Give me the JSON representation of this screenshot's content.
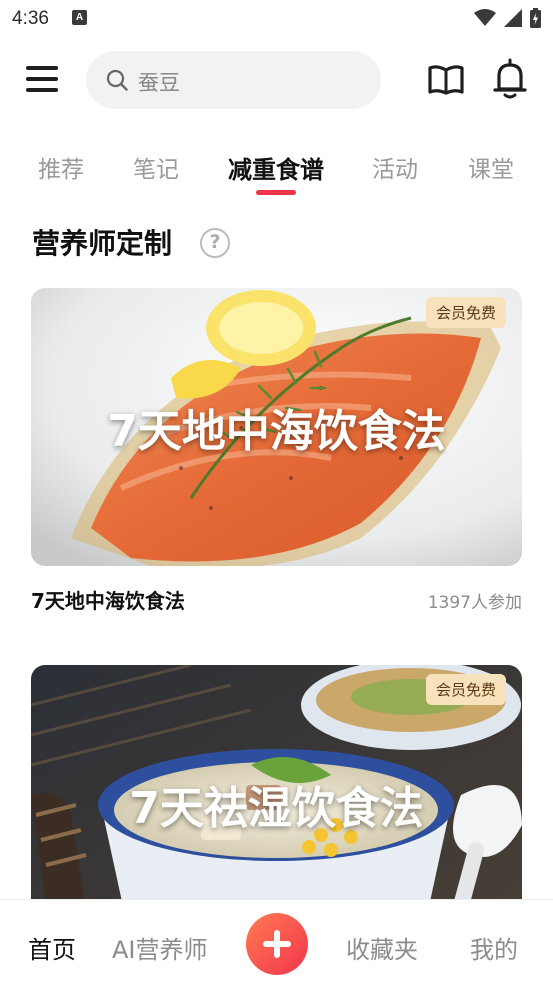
{
  "status_bar": {
    "time": "4:36",
    "notification_letter": "A"
  },
  "header": {
    "search_placeholder": "蚕豆"
  },
  "tabs": [
    {
      "label": "推荐"
    },
    {
      "label": "笔记"
    },
    {
      "label": "减重食谱",
      "active": true
    },
    {
      "label": "活动"
    },
    {
      "label": "课堂"
    }
  ],
  "section": {
    "title": "营养师定制",
    "help_glyph": "?"
  },
  "cards": [
    {
      "overlay_title": "7天地中海饮食法",
      "badge": "会员免费",
      "name": "7天地中海饮食法",
      "participants": "1397人参加",
      "image_icon": "salmon-dish-photo"
    },
    {
      "overlay_title": "7天祛湿饮食法",
      "badge": "会员免费",
      "name": "",
      "participants": "",
      "image_icon": "soup-bowl-photo"
    }
  ],
  "bottom_nav": {
    "home": "首页",
    "ai": "AI营养师",
    "favorites": "收藏夹",
    "mine": "我的"
  },
  "colors": {
    "accent": "#f0344a",
    "badge_bg": "#f8e2bc",
    "plus_gradient_start": "#ff7b52",
    "plus_gradient_end": "#f2344c"
  }
}
